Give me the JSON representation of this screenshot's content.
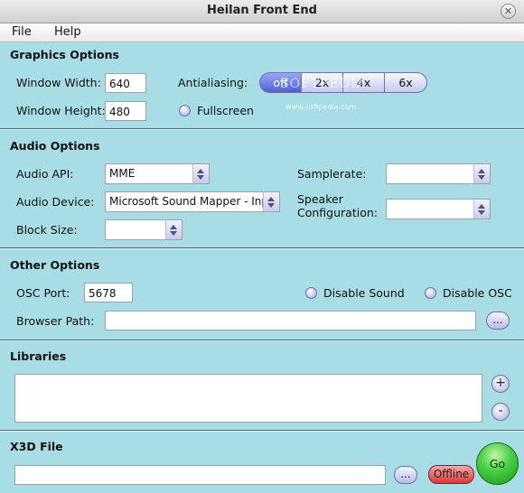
{
  "window": {
    "title": "Heilan Front End"
  },
  "menu": {
    "file": "File",
    "help": "Help"
  },
  "graphics": {
    "title": "Graphics Options",
    "window_width_label": "Window Width:",
    "window_width_value": "640",
    "window_height_label": "Window Height:",
    "window_height_value": "480",
    "antialiasing_label": "Antialiasing:",
    "antialiasing_options": [
      "off",
      "2x",
      "4x",
      "6x"
    ],
    "antialiasing_selected": "off",
    "fullscreen_label": "Fullscreen"
  },
  "audio": {
    "title": "Audio Options",
    "api_label": "Audio API:",
    "api_value": "MME",
    "device_label": "Audio Device:",
    "device_value": "Microsoft Sound Mapper - Input",
    "block_size_label": "Block Size:",
    "block_size_value": "",
    "samplerate_label": "Samplerate:",
    "samplerate_value": "",
    "speaker_label_line1": "Speaker",
    "speaker_label_line2": "Configuration:",
    "speaker_value": ""
  },
  "other": {
    "title": "Other Options",
    "osc_port_label": "OSC Port:",
    "osc_port_value": "5678",
    "disable_sound_label": "Disable Sound",
    "disable_osc_label": "Disable OSC",
    "browser_path_label": "Browser Path:",
    "browser_path_value": "",
    "browse_label": "..."
  },
  "libraries": {
    "title": "Libraries",
    "add_label": "+",
    "remove_label": "-"
  },
  "x3d": {
    "title": "X3D File",
    "file_value": "",
    "browse_label": "...",
    "offline_label": "Offline",
    "go_label": "Go"
  },
  "watermark": {
    "text": "SOFTPEDIA",
    "url": "www.softpedia.com"
  },
  "colors": {
    "background": "#a8dde6",
    "selected_segment": "#4d5fd9",
    "go_button": "#2db82d",
    "offline_button": "#d63a3a"
  }
}
